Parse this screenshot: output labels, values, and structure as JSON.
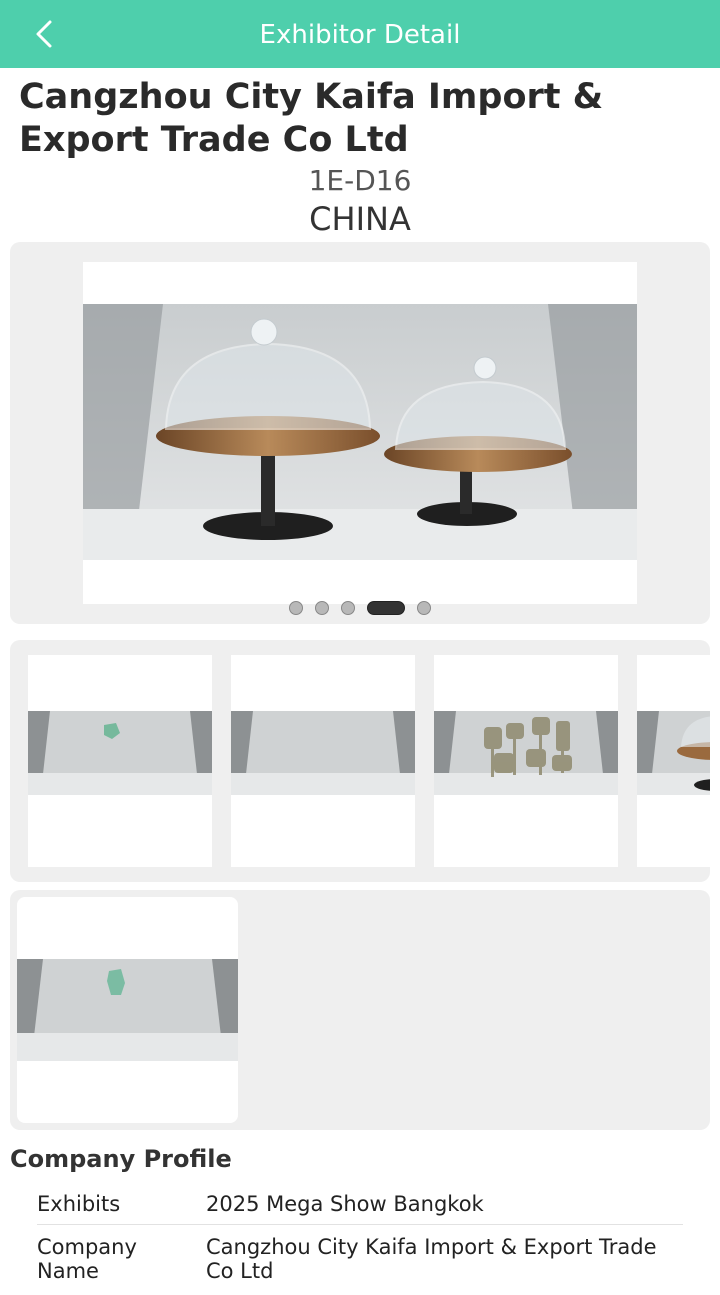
{
  "header": {
    "title": "Exhibitor Detail",
    "back_icon": "chevron-left-icon"
  },
  "exhibitor": {
    "name": "Cangzhou City Kaifa Import & Export Trade Co Ltd",
    "booth": "1E-D16",
    "country": "CHINA"
  },
  "carousel": {
    "slide_count": 5,
    "active_index": 3
  },
  "gallery": {
    "thumbnail_count": 4,
    "extra_thumbnail_count": 1
  },
  "profile": {
    "heading": "Company Profile",
    "rows": [
      {
        "label": "Exhibits",
        "value": "2025 Mega Show Bangkok"
      },
      {
        "label": "Company Name",
        "value": "Cangzhou City Kaifa Import & Export Trade Co Ltd"
      }
    ]
  },
  "colors": {
    "accent": "#4ecfac",
    "panel": "#efefef"
  }
}
